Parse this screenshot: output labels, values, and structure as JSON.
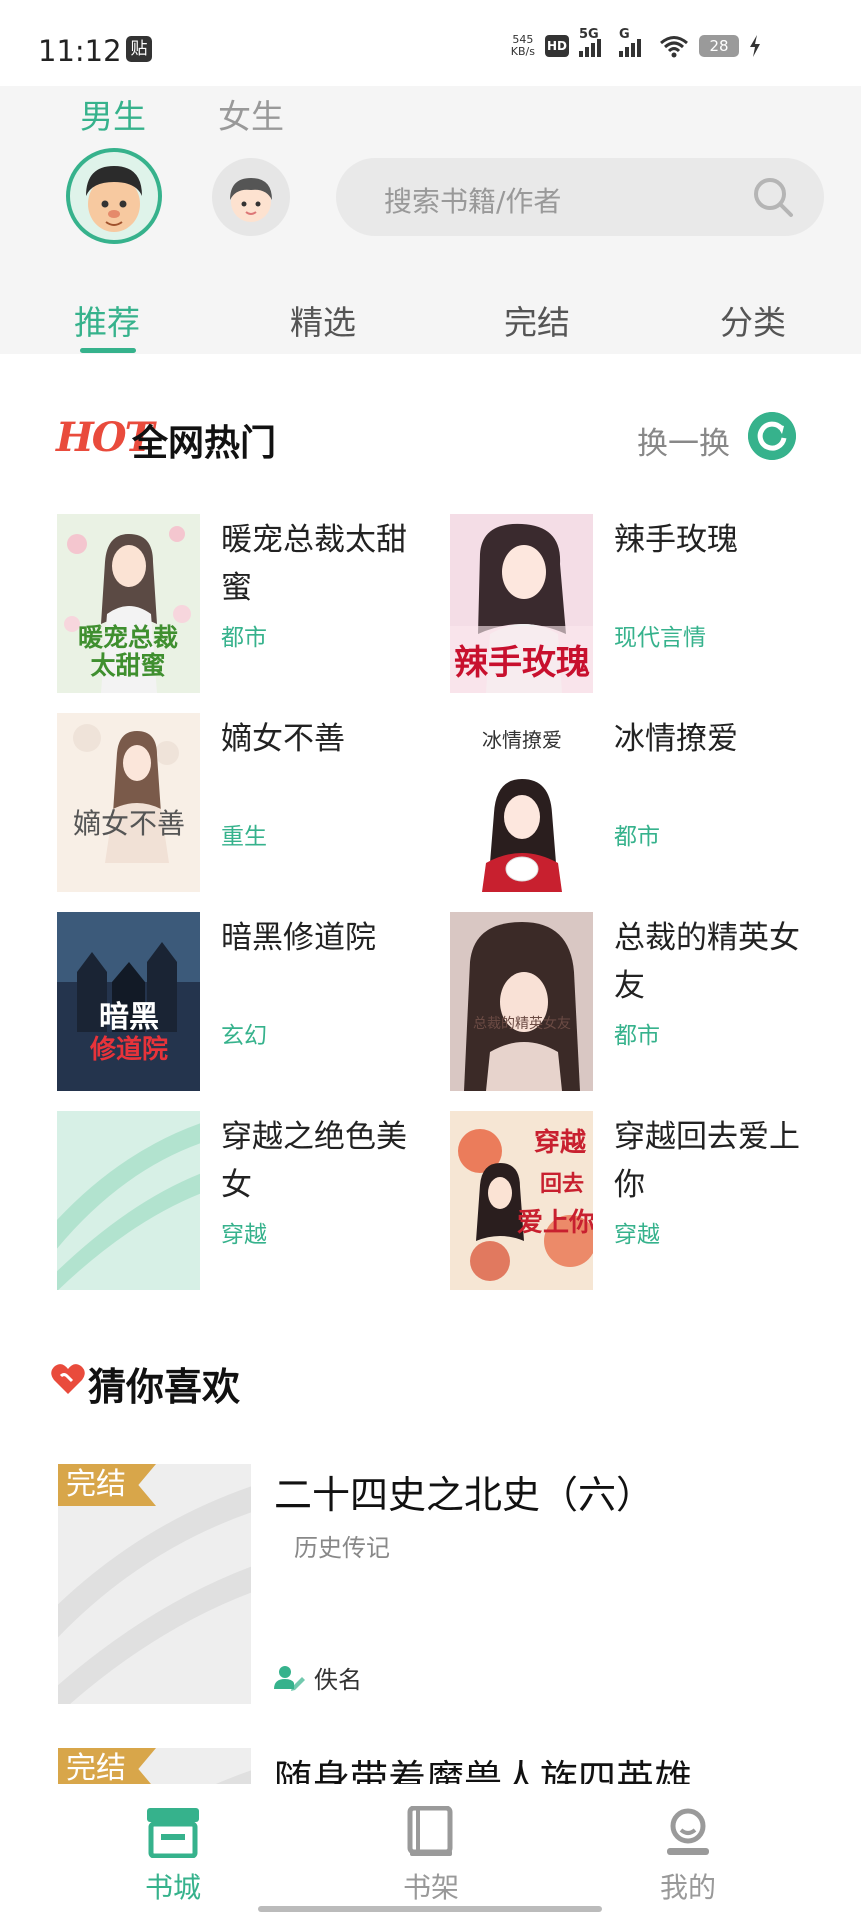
{
  "status_bar": {
    "time": "11:12",
    "notification_badge": "贴",
    "speed_value": "545",
    "speed_unit": "KB/s",
    "hd_label": "HD",
    "net1": "5G",
    "net2": "G",
    "battery": "28"
  },
  "header": {
    "gender_tabs": [
      {
        "label": "男生",
        "active": true
      },
      {
        "label": "女生",
        "active": false
      }
    ],
    "search_placeholder": "搜索书籍/作者",
    "nav_tabs": [
      {
        "label": "推荐",
        "active": true
      },
      {
        "label": "精选",
        "active": false
      },
      {
        "label": "完结",
        "active": false
      },
      {
        "label": "分类",
        "active": false
      }
    ]
  },
  "hot_section": {
    "mark": "HOT",
    "title": "全网热门",
    "refresh_label": "换一换",
    "books": [
      {
        "title": "暖宠总裁太甜蜜",
        "tag": "都市",
        "cover_text": "暖宠总裁太甜蜜"
      },
      {
        "title": "辣手玫瑰",
        "tag": "现代言情",
        "cover_text": "辣手玫瑰"
      },
      {
        "title": "嫡女不善",
        "tag": "重生",
        "cover_text": "嫡女不善"
      },
      {
        "title": "冰情撩爱",
        "tag": "都市",
        "cover_text": "冰情撩爱"
      },
      {
        "title": "暗黑修道院",
        "tag": "玄幻",
        "cover_text": "暗黑修道院"
      },
      {
        "title": "总裁的精英女友",
        "tag": "都市",
        "cover_text": "总裁的精英女友"
      },
      {
        "title": "穿越之绝色美女",
        "tag": "穿越",
        "cover_text": ""
      },
      {
        "title": "穿越回去爱上你",
        "tag": "穿越",
        "cover_text": "穿越回去爱上你"
      }
    ]
  },
  "guess_section": {
    "title": "猜你喜欢",
    "items": [
      {
        "badge": "完结",
        "title": "二十四史之北史（六）",
        "category": "历史传记",
        "author": "佚名"
      },
      {
        "badge": "完结",
        "title": "随身带着魔兽人族四英雄",
        "category": "",
        "author": ""
      }
    ]
  },
  "bottom_nav": [
    {
      "label": "书城",
      "icon": "store-icon",
      "active": true
    },
    {
      "label": "书架",
      "icon": "bookshelf-icon",
      "active": false
    },
    {
      "label": "我的",
      "icon": "profile-icon",
      "active": false
    }
  ],
  "colors": {
    "accent": "#36b28c",
    "hot": "#e94b3c",
    "badge": "#d8a64a"
  }
}
